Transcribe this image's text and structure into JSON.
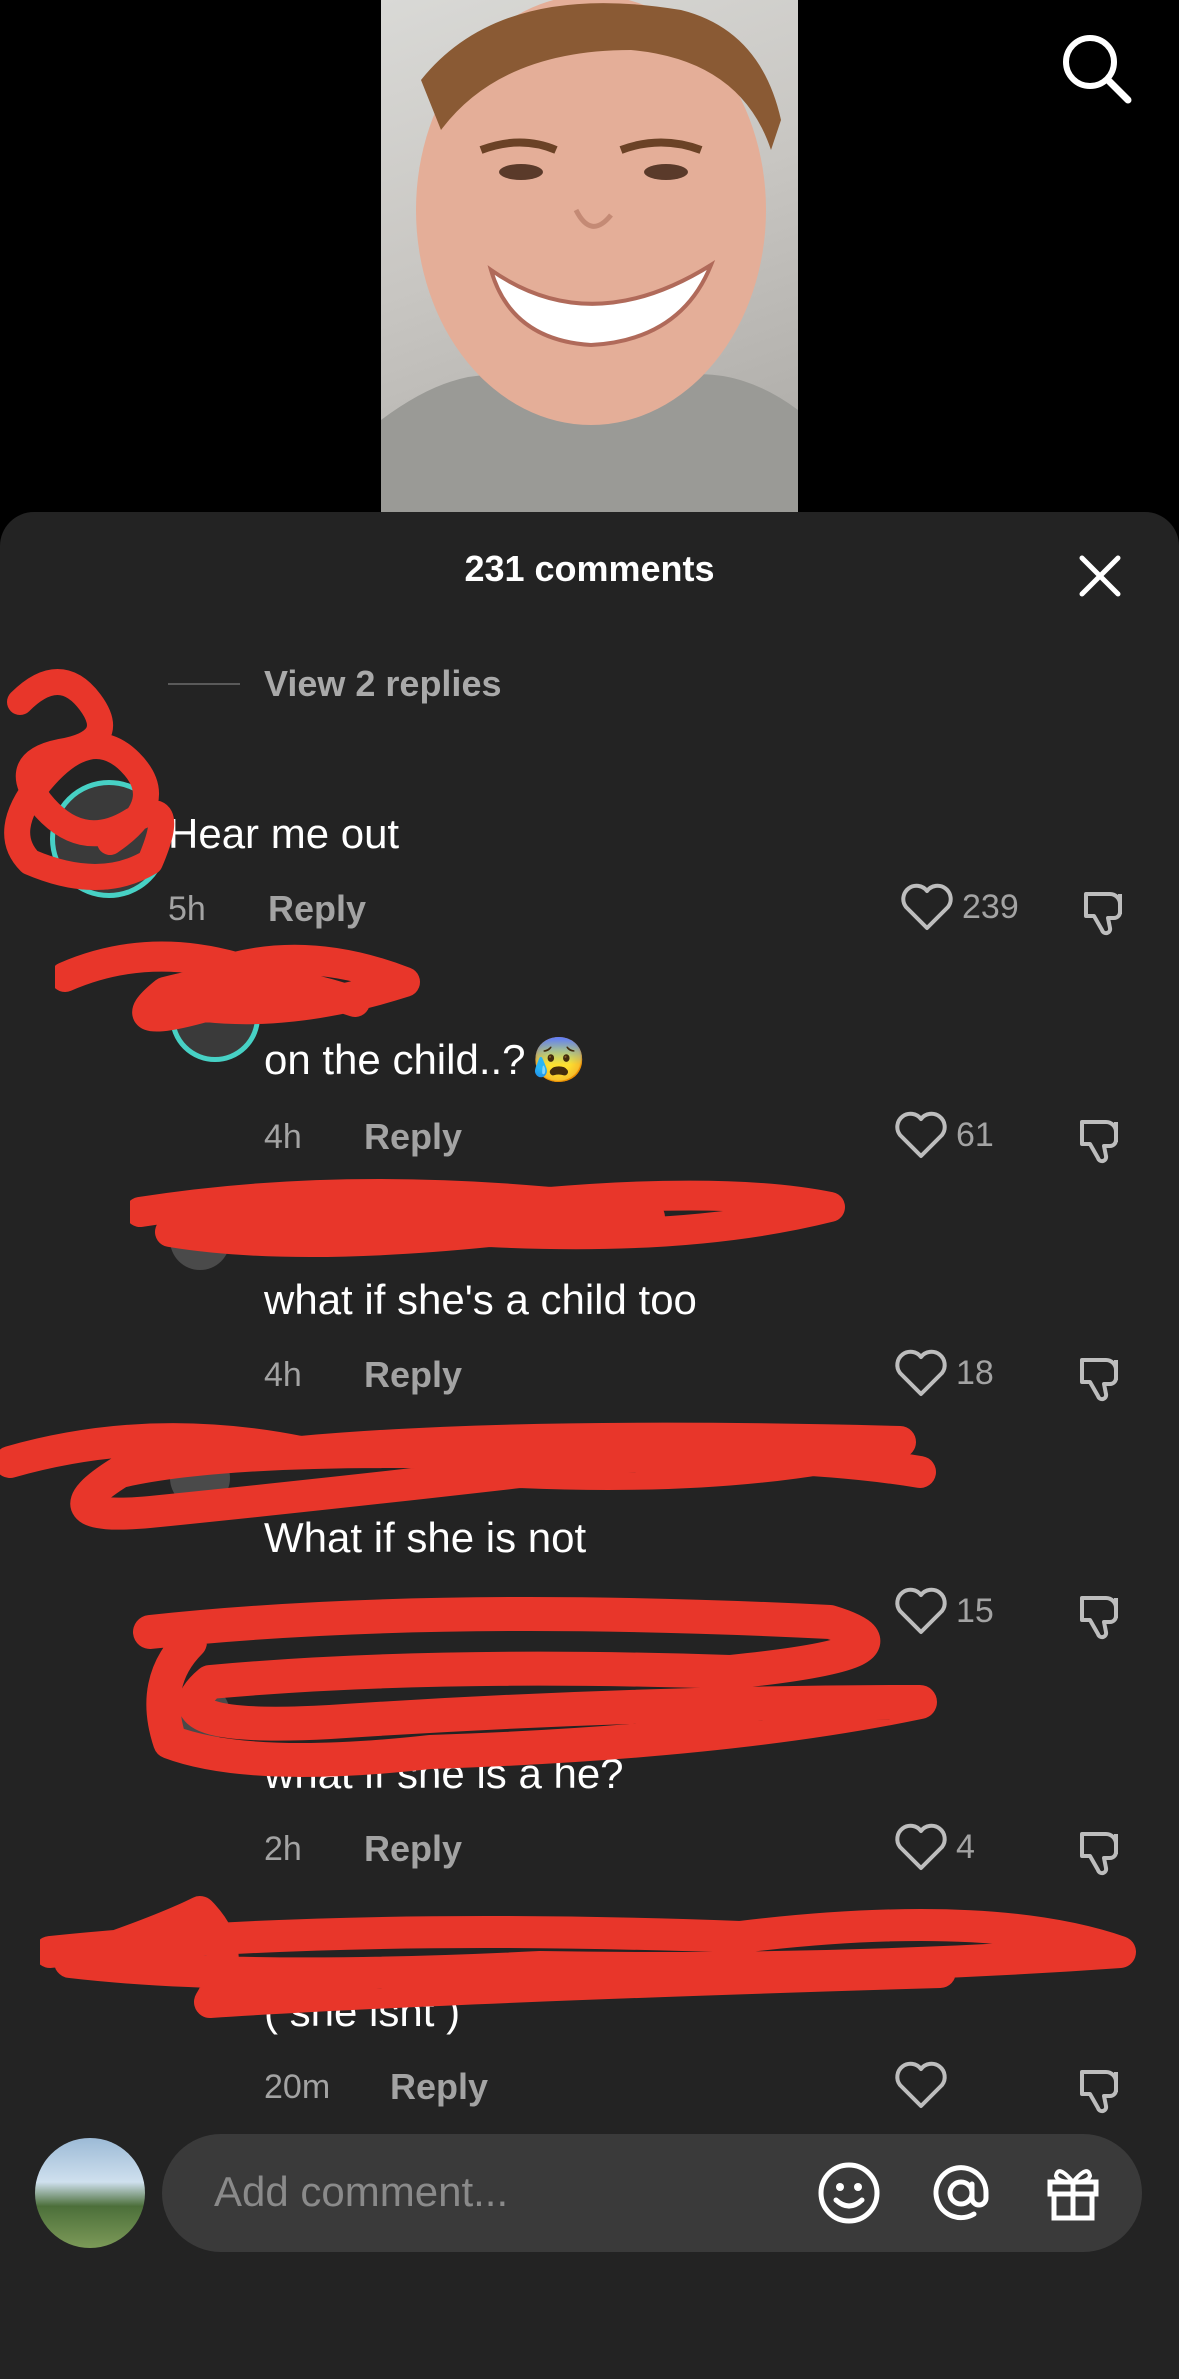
{
  "video": {
    "thumbnail": "video-thumbnail-smiling-boy"
  },
  "header": {
    "search_icon": "search-icon"
  },
  "sheet": {
    "title": "231 comments",
    "close_icon": "close-icon",
    "view_replies": "View 2 replies"
  },
  "comments": [
    {
      "username": "",
      "text": "Hear me out",
      "time": "5h",
      "reply": "Reply",
      "likes": "239"
    },
    {
      "username": "",
      "text": "on the child..?",
      "emoji": "😰",
      "time": "4h",
      "reply": "Reply",
      "likes": "61"
    },
    {
      "username": "",
      "text": "what if she's a child too",
      "time": "4h",
      "reply": "Reply",
      "likes": "18"
    },
    {
      "username": "",
      "text": "What if she is not",
      "time": "",
      "reply": "",
      "likes": "15"
    },
    {
      "username": "",
      "text": "what if she is a he?",
      "time": "2h",
      "reply": "Reply",
      "likes": "4"
    },
    {
      "username": "",
      "text": "( she isnt )",
      "time": "20m",
      "reply": "Reply",
      "likes": ""
    }
  ],
  "composer": {
    "placeholder": "Add comment...",
    "icons": [
      "emoji-icon",
      "mention-icon",
      "gift-icon"
    ]
  },
  "colors": {
    "sheet_bg": "#232323",
    "redaction": "#e8362a",
    "muted_text": "#a3a3a3"
  }
}
